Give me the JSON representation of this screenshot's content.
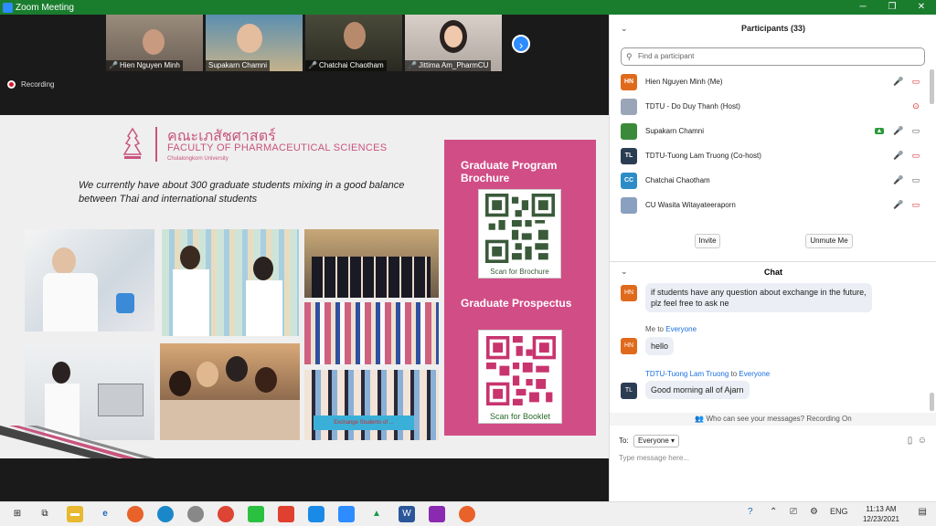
{
  "window": {
    "title": "Zoom Meeting"
  },
  "participants_thumbs": [
    {
      "name": "Hien Nguyen Minh"
    },
    {
      "name": "Supakarn Chamni"
    },
    {
      "name": "Chatchai Chaotham"
    },
    {
      "name": "Jittima Am_PharmCU"
    }
  ],
  "recording_label": "Recording",
  "slide": {
    "thai_name": "คณะเภสัชศาสตร์",
    "faculty": "FACULTY OF PHARMACEUTICAL SCIENCES",
    "university": "Chulalongkorn University",
    "text": "We currently have about 300 graduate students mixing in a good balance between Thai and international students",
    "brochure_title": "Graduate Program Brochure",
    "brochure_caption": "Scan for Brochure",
    "prospectus_title": "Graduate Prospectus",
    "prospectus_caption": "Scan for Booklet",
    "banner_text": "Exchange Students of ..."
  },
  "panel": {
    "participants_title": "Participants (33)",
    "search_placeholder": "Find a participant",
    "participants": [
      {
        "initials": "HN",
        "name": "Hien Nguyen Minh (Me)",
        "color": "#e06a1c",
        "icons": "🎤̸ 📷"
      },
      {
        "initials": "",
        "name": "TDTU - Do Duy Thanh (Host)",
        "color": "#9aa6b8",
        "icons": "⊙"
      },
      {
        "initials": "",
        "name": "Supakarn Chamni",
        "color": "#3a8a3a",
        "icons": "🎤 📷"
      },
      {
        "initials": "TL",
        "name": "TDTU-Tuong Lam Truong (Co-host)",
        "color": "#2b3d52",
        "icons": "🎤̸ 📷̸"
      },
      {
        "initials": "CC",
        "name": "Chatchai Chaotham",
        "color": "#2d8cc8",
        "icons": "🎤̸ 📷"
      },
      {
        "initials": "",
        "name": "CU Wasita Witayateeraporn",
        "color": "#8aa0c0",
        "icons": "🎤̸ 📷̸"
      }
    ],
    "invite_label": "Invite",
    "unmute_label": "Unmute Me",
    "chat_title": "Chat",
    "messages": [
      {
        "initials": "HN",
        "from": "",
        "to": "",
        "text": "if students have any question about exchange in the future, plz feel free to ask ne"
      },
      {
        "initials": "HN",
        "from": "Me to ",
        "to": "Everyone",
        "text": "hello"
      },
      {
        "initials": "TL",
        "from": "TDTU-Tuong Lam Truong",
        "from_mid": " to ",
        "to": "Everyone",
        "text": "Good morning all of Ajarn"
      }
    ],
    "who_can_see": "Who can see your messages? Recording On",
    "to_label": "To:",
    "to_value": "Everyone",
    "type_placeholder": "Type message here..."
  },
  "taskbar": {
    "time": "11:13 AM",
    "date": "12/23/2021",
    "lang": "ENG"
  }
}
